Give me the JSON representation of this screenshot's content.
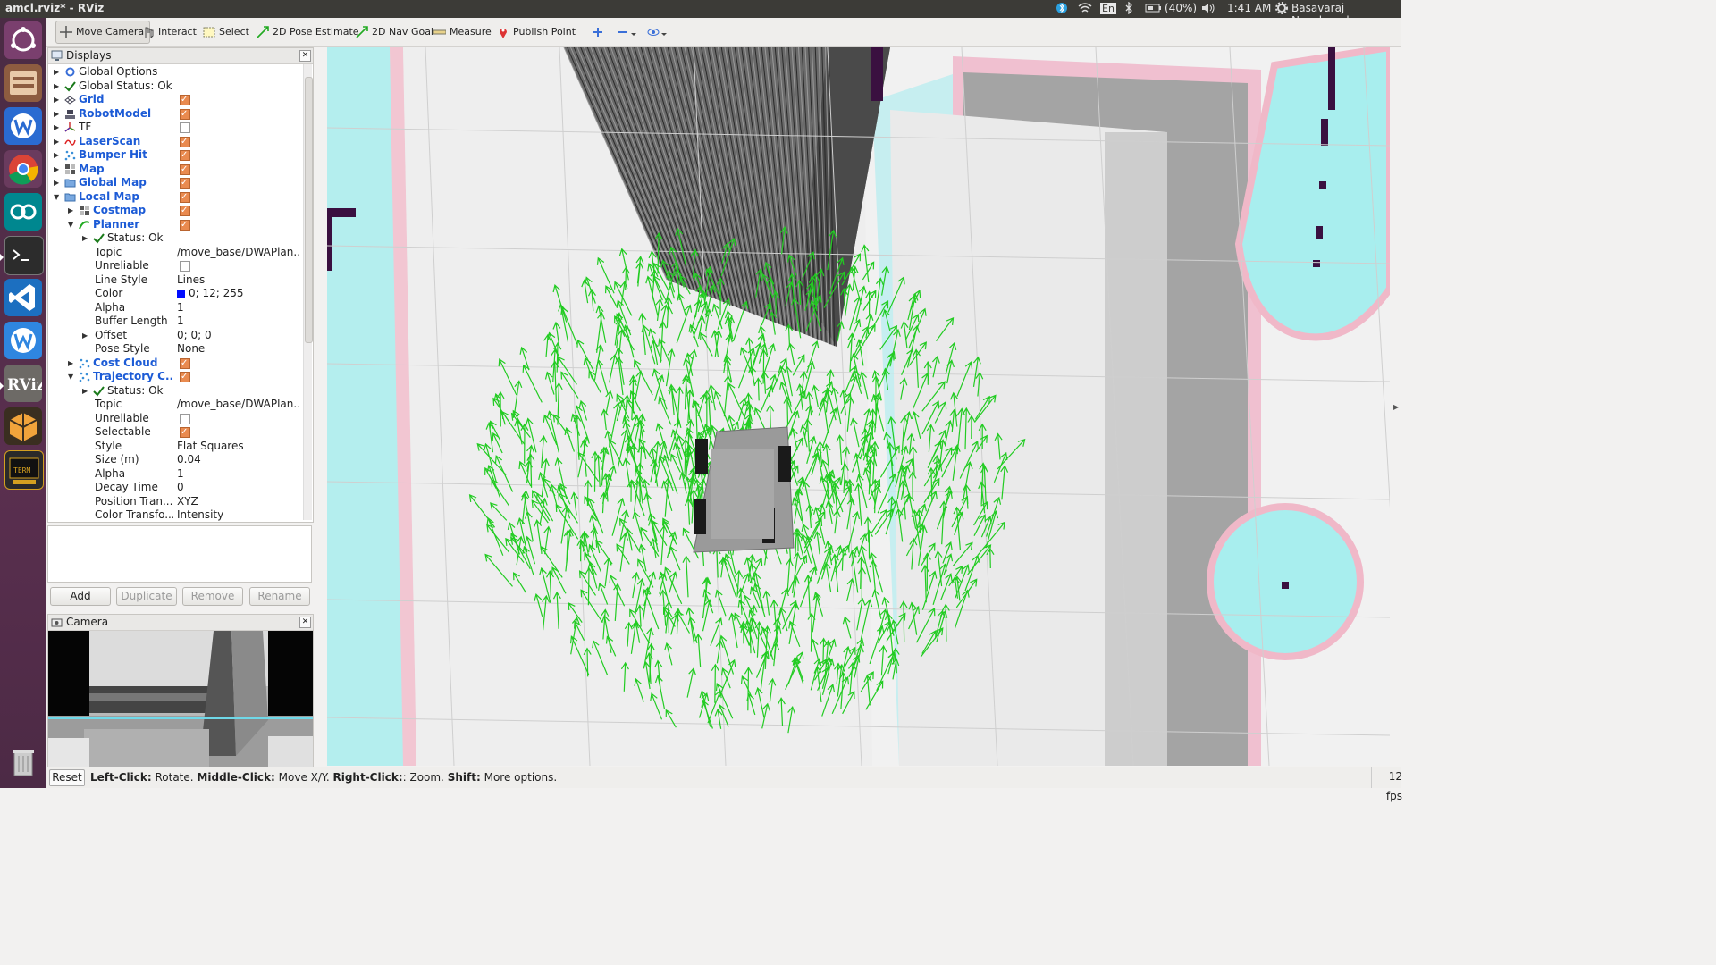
{
  "window": {
    "title": "amcl.rviz* - RViz"
  },
  "system_tray": {
    "language": "En",
    "battery": "(40%)",
    "clock": "1:41 AM",
    "user": "Basavaraj Navalgund"
  },
  "launcher": {
    "items": [
      "ubuntu-icon",
      "files-icon",
      "wps-writer-icon",
      "chrome-icon",
      "arduino-icon",
      "terminal-icon",
      "vscode-icon",
      "wps-icon",
      "rviz-icon",
      "blender-icon",
      "xterm-icon",
      "trash-icon"
    ],
    "rviz_label": "RViz",
    "xterm_label": "TERM"
  },
  "toolbar": {
    "move_camera": "Move Camera",
    "interact": "Interact",
    "select": "Select",
    "pose_estimate": "2D Pose Estimate",
    "nav_goal": "2D Nav Goal",
    "measure": "Measure",
    "publish_point": "Publish Point"
  },
  "displays": {
    "title": "Displays",
    "rows": [
      {
        "label": "Global Options",
        "indent": 0,
        "arrow": "▶",
        "icon": "gear-icon"
      },
      {
        "label": "Global Status: Ok",
        "indent": 0,
        "arrow": "▶",
        "icon": "check-icon"
      },
      {
        "label": "Grid",
        "indent": 0,
        "arrow": "▶",
        "icon": "grid-icon",
        "blue": true,
        "check": true
      },
      {
        "label": "RobotModel",
        "indent": 0,
        "arrow": "▶",
        "icon": "robot-icon",
        "blue": true,
        "check": true
      },
      {
        "label": "TF",
        "indent": 0,
        "arrow": "▶",
        "icon": "tf-icon",
        "check": false
      },
      {
        "label": "LaserScan",
        "indent": 0,
        "arrow": "▶",
        "icon": "laser-icon",
        "blue": true,
        "check": true
      },
      {
        "label": "Bumper Hit",
        "indent": 0,
        "arrow": "▶",
        "icon": "points-icon",
        "blue": true,
        "check": true
      },
      {
        "label": "Map",
        "indent": 0,
        "arrow": "▶",
        "icon": "map-icon",
        "blue": true,
        "check": true
      },
      {
        "label": "Global Map",
        "indent": 0,
        "arrow": "▶",
        "icon": "folder-icon",
        "blue": true,
        "check": true
      },
      {
        "label": "Local Map",
        "indent": 0,
        "arrow": "▼",
        "icon": "folder-icon",
        "blue": true,
        "check": true
      },
      {
        "label": "Costmap",
        "indent": 1,
        "arrow": "▶",
        "icon": "map-icon",
        "blue": true,
        "check": true
      },
      {
        "label": "Planner",
        "indent": 1,
        "arrow": "▼",
        "icon": "path-icon",
        "blue": true,
        "check": true
      },
      {
        "label": "Status: Ok",
        "indent": 2,
        "arrow": "▶",
        "icon": "check-icon"
      },
      {
        "label": "Topic",
        "indent": 2,
        "value": "/move_base/DWAPlan..."
      },
      {
        "label": "Unreliable",
        "indent": 2,
        "check": false
      },
      {
        "label": "Line Style",
        "indent": 2,
        "value": "Lines"
      },
      {
        "label": "Color",
        "indent": 2,
        "value": "0; 12; 255",
        "swatch": "#000cff"
      },
      {
        "label": "Alpha",
        "indent": 2,
        "value": "1"
      },
      {
        "label": "Buffer Length",
        "indent": 2,
        "value": "1"
      },
      {
        "label": "Offset",
        "indent": 2,
        "arrow": "▶",
        "value": "0; 0; 0"
      },
      {
        "label": "Pose Style",
        "indent": 2,
        "value": "None"
      },
      {
        "label": "Cost Cloud",
        "indent": 1,
        "arrow": "▶",
        "icon": "points-icon",
        "blue": true,
        "check": true
      },
      {
        "label": "Trajectory C...",
        "indent": 1,
        "arrow": "▼",
        "icon": "points-icon",
        "blue": true,
        "check": true
      },
      {
        "label": "Status: Ok",
        "indent": 2,
        "arrow": "▶",
        "icon": "check-icon"
      },
      {
        "label": "Topic",
        "indent": 2,
        "value": "/move_base/DWAPlan..."
      },
      {
        "label": "Unreliable",
        "indent": 2,
        "check": false
      },
      {
        "label": "Selectable",
        "indent": 2,
        "check": true
      },
      {
        "label": "Style",
        "indent": 2,
        "value": "Flat Squares"
      },
      {
        "label": "Size (m)",
        "indent": 2,
        "value": "0.04"
      },
      {
        "label": "Alpha",
        "indent": 2,
        "value": "1"
      },
      {
        "label": "Decay Time",
        "indent": 2,
        "value": "0"
      },
      {
        "label": "Position Tran...",
        "indent": 2,
        "value": "XYZ"
      },
      {
        "label": "Color Transfo...",
        "indent": 2,
        "value": "Intensity"
      }
    ]
  },
  "buttons": {
    "add": "Add",
    "duplicate": "Duplicate",
    "remove": "Remove",
    "rename": "Rename"
  },
  "camera": {
    "title": "Camera"
  },
  "statusbar": {
    "reset": "Reset",
    "left_click": "Left-Click:",
    "left_click_action": "Rotate.",
    "middle_click": "Middle-Click:",
    "middle_click_action": "Move X/Y.",
    "right_click": "Right-Click:",
    "right_click_action": ": Zoom.",
    "shift": "Shift:",
    "shift_action": "More options.",
    "fps": "12 fps"
  },
  "colors": {
    "trajectory": "#22cc22",
    "costmap_cyan": "#a8f0f0",
    "costmap_pink": "#f0b8c8",
    "obstacle": "#3a1040"
  }
}
